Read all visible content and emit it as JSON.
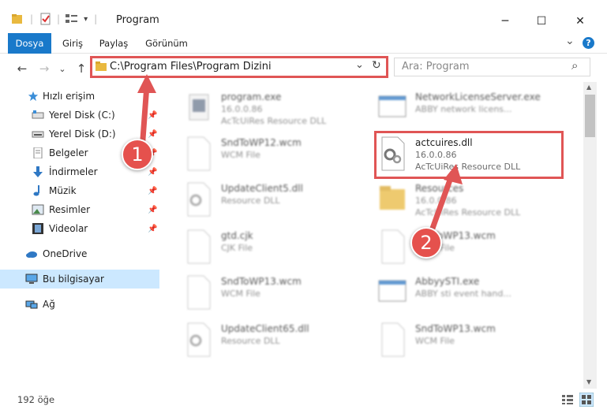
{
  "window": {
    "title": "Program",
    "minimize_glyph": "─",
    "maximize_glyph": "☐",
    "close_glyph": "✕"
  },
  "ribbon": {
    "tabs": [
      "Dosya",
      "Giriş",
      "Paylaş",
      "Görünüm"
    ],
    "help_glyph": "?",
    "expand_glyph": "⌄"
  },
  "address": {
    "back": "←",
    "forward": "→",
    "recent": "⌄",
    "up": "↑",
    "path": "C:\\Program Files\\Program Dizini",
    "dropdown": "⌄",
    "refresh": "↻"
  },
  "search": {
    "placeholder": "Ara: Program",
    "icon": "⌕"
  },
  "sidebar": {
    "items": [
      {
        "label": "Hızlı erişim"
      },
      {
        "label": "Yerel Disk (C:)"
      },
      {
        "label": "Yerel Disk (D:)"
      },
      {
        "label": "Belgeler"
      },
      {
        "label": "İndirmeler"
      },
      {
        "label": "Müzik"
      },
      {
        "label": "Resimler"
      },
      {
        "label": "Videolar"
      },
      {
        "label": "OneDrive"
      },
      {
        "label": "Bu bilgisayar"
      },
      {
        "label": "Ağ"
      }
    ],
    "pin_glyph": "📌"
  },
  "files": [
    {
      "name": "program.exe",
      "line2": "16.0.0.86",
      "line3": "AcTcUiRes Resource DLL"
    },
    {
      "name": "NetworkLicenseServer.exe",
      "line2": "ABBY network licens...",
      "line3": ""
    },
    {
      "name": "SndToWP12.wcm",
      "line2": "WCM File",
      "line3": ""
    },
    {
      "name": "actcuires.dll",
      "line2": "16.0.0.86",
      "line3": "AcTcUiRes Resource DLL"
    },
    {
      "name": "UpdateClient5.dll",
      "line2": "Resource DLL",
      "line3": ""
    },
    {
      "name": "Resources",
      "line2": "16.0.0.86",
      "line3": "AcTcUiRes Resource DLL"
    },
    {
      "name": "gtd.cjk",
      "line2": "CJK File",
      "line3": ""
    },
    {
      "name": "SndToWP13.wcm",
      "line2": "WCM File",
      "line3": ""
    },
    {
      "name": "SndToWP13.wcm",
      "line2": "WCM File",
      "line3": ""
    },
    {
      "name": "AbbyySTI.exe",
      "line2": "ABBY sti event hand...",
      "line3": ""
    },
    {
      "name": "UpdateClient65.dll",
      "line2": "Resource DLL",
      "line3": ""
    },
    {
      "name": "SndToWP13.wcm",
      "line2": "WCM File",
      "line3": ""
    }
  ],
  "status": {
    "count": "192 öğe"
  },
  "annotations": {
    "step1": "1",
    "step2": "2"
  },
  "colors": {
    "accent": "#1979ca",
    "annotation": "#e05555"
  }
}
